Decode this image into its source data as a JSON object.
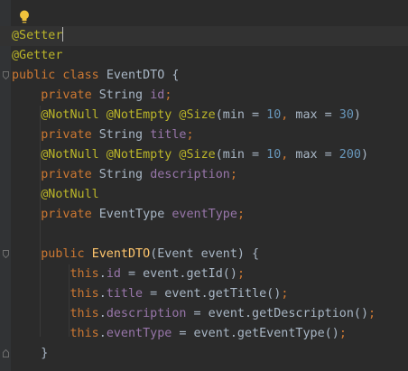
{
  "icons": {
    "intention_bulb": "lightbulb-icon",
    "fold_marker": "fold-marker-icon"
  },
  "colors": {
    "background": "#2b2b2b",
    "plain_text": "#a9b7c6",
    "annotation": "#bbb529",
    "keyword": "#cc7832",
    "field": "#9876aa",
    "number": "#6897bb",
    "method_declaration": "#ffc66d",
    "bulb": "#f0c23c"
  },
  "code": {
    "lines": [
      {
        "tokens": [
          {
            "t": "@Setter",
            "c": "ann"
          }
        ]
      },
      {
        "tokens": [
          {
            "t": "@Getter",
            "c": "ann"
          }
        ]
      },
      {
        "tokens": [
          {
            "t": "public class ",
            "c": "kw"
          },
          {
            "t": "EventDTO {",
            "c": "pl"
          }
        ]
      },
      {
        "tokens": [
          {
            "t": "    ",
            "c": "pl"
          },
          {
            "t": "private ",
            "c": "kw"
          },
          {
            "t": "String ",
            "c": "pl"
          },
          {
            "t": "id",
            "c": "fld"
          },
          {
            "t": ";",
            "c": "kw"
          }
        ]
      },
      {
        "tokens": [
          {
            "t": "    ",
            "c": "pl"
          },
          {
            "t": "@NotNull @NotEmpty @Size",
            "c": "ann"
          },
          {
            "t": "(min = ",
            "c": "pl"
          },
          {
            "t": "10",
            "c": "num"
          },
          {
            "t": ", ",
            "c": "kw"
          },
          {
            "t": "max = ",
            "c": "pl"
          },
          {
            "t": "30",
            "c": "num"
          },
          {
            "t": ")",
            "c": "pl"
          }
        ]
      },
      {
        "tokens": [
          {
            "t": "    ",
            "c": "pl"
          },
          {
            "t": "private ",
            "c": "kw"
          },
          {
            "t": "String ",
            "c": "pl"
          },
          {
            "t": "title",
            "c": "fld"
          },
          {
            "t": ";",
            "c": "kw"
          }
        ]
      },
      {
        "tokens": [
          {
            "t": "    ",
            "c": "pl"
          },
          {
            "t": "@NotNull @NotEmpty @Size",
            "c": "ann"
          },
          {
            "t": "(min = ",
            "c": "pl"
          },
          {
            "t": "10",
            "c": "num"
          },
          {
            "t": ", ",
            "c": "kw"
          },
          {
            "t": "max = ",
            "c": "pl"
          },
          {
            "t": "200",
            "c": "num"
          },
          {
            "t": ")",
            "c": "pl"
          }
        ]
      },
      {
        "tokens": [
          {
            "t": "    ",
            "c": "pl"
          },
          {
            "t": "private ",
            "c": "kw"
          },
          {
            "t": "String ",
            "c": "pl"
          },
          {
            "t": "description",
            "c": "fld"
          },
          {
            "t": ";",
            "c": "kw"
          }
        ]
      },
      {
        "tokens": [
          {
            "t": "    ",
            "c": "pl"
          },
          {
            "t": "@NotNull",
            "c": "ann"
          }
        ]
      },
      {
        "tokens": [
          {
            "t": "    ",
            "c": "pl"
          },
          {
            "t": "private ",
            "c": "kw"
          },
          {
            "t": "EventType ",
            "c": "pl"
          },
          {
            "t": "eventType",
            "c": "fld"
          },
          {
            "t": ";",
            "c": "kw"
          }
        ]
      },
      {
        "tokens": []
      },
      {
        "tokens": [
          {
            "t": "    ",
            "c": "pl"
          },
          {
            "t": "public ",
            "c": "kw"
          },
          {
            "t": "EventDTO",
            "c": "fn"
          },
          {
            "t": "(Event event) {",
            "c": "pl"
          }
        ]
      },
      {
        "tokens": [
          {
            "t": "        ",
            "c": "pl"
          },
          {
            "t": "this",
            "c": "kw"
          },
          {
            "t": ".",
            "c": "pl"
          },
          {
            "t": "id",
            "c": "fld"
          },
          {
            "t": " = event.getId()",
            "c": "pl"
          },
          {
            "t": ";",
            "c": "kw"
          }
        ]
      },
      {
        "tokens": [
          {
            "t": "        ",
            "c": "pl"
          },
          {
            "t": "this",
            "c": "kw"
          },
          {
            "t": ".",
            "c": "pl"
          },
          {
            "t": "title",
            "c": "fld"
          },
          {
            "t": " = event.getTitle()",
            "c": "pl"
          },
          {
            "t": ";",
            "c": "kw"
          }
        ]
      },
      {
        "tokens": [
          {
            "t": "        ",
            "c": "pl"
          },
          {
            "t": "this",
            "c": "kw"
          },
          {
            "t": ".",
            "c": "pl"
          },
          {
            "t": "description",
            "c": "fld"
          },
          {
            "t": " = event.getDescription()",
            "c": "pl"
          },
          {
            "t": ";",
            "c": "kw"
          }
        ]
      },
      {
        "tokens": [
          {
            "t": "        ",
            "c": "pl"
          },
          {
            "t": "this",
            "c": "kw"
          },
          {
            "t": ".",
            "c": "pl"
          },
          {
            "t": "eventType",
            "c": "fld"
          },
          {
            "t": " = event.getEventType()",
            "c": "pl"
          },
          {
            "t": ";",
            "c": "kw"
          }
        ]
      },
      {
        "tokens": [
          {
            "t": "    }",
            "c": "pl"
          }
        ]
      }
    ]
  }
}
